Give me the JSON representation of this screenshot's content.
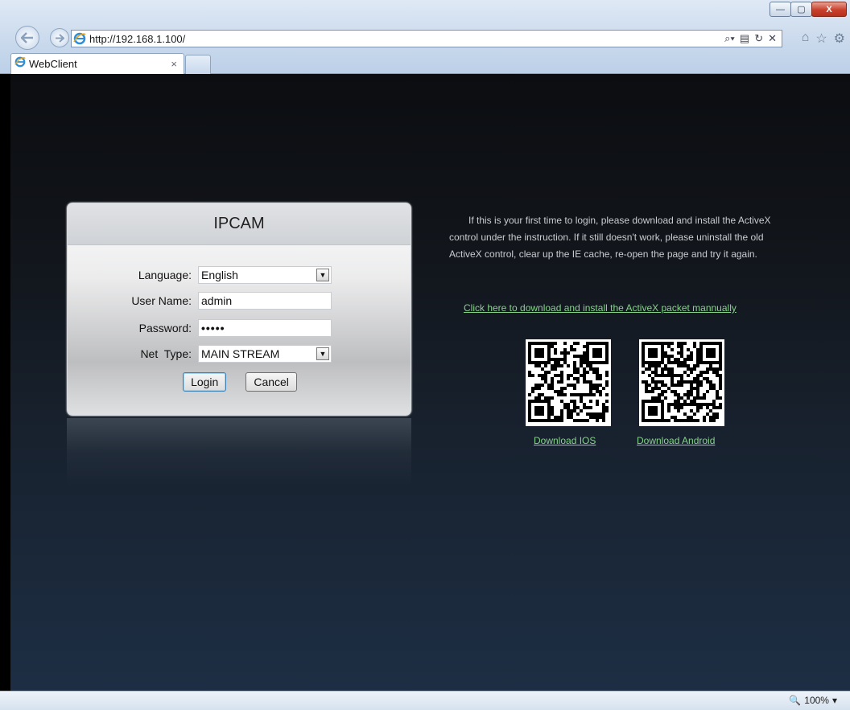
{
  "browser": {
    "url": "http://192.168.1.100/",
    "tab_title": "WebClient",
    "tab_close": "×",
    "window_buttons": {
      "minimize": "—",
      "maximize": "▢",
      "close": "X"
    },
    "zoom": "100%",
    "icons": [
      "back-arrow-icon",
      "forward-arrow-icon",
      "ie-logo-icon",
      "search-icon",
      "compat-view-icon",
      "refresh-icon",
      "stop-icon",
      "home-icon",
      "favorites-star-icon",
      "settings-gear-icon",
      "zoom-icon"
    ]
  },
  "login": {
    "title": "IPCAM",
    "language_label": "Language:",
    "language_value": "English",
    "username_label": "User Name:",
    "username_value": "admin",
    "password_label": "Password:",
    "password_value": "•••••",
    "nettype_label": "Net  Type:",
    "nettype_value": "MAIN STREAM",
    "login_button": "Login",
    "cancel_button": "Cancel"
  },
  "info": {
    "text": "If this is your first time to login, please download and install the ActiveX control under the instruction. If it still doesn't work, please uninstall the old ActiveX control, clear up the IE cache, re-open the page and try it again.",
    "activex_link": "Click here to download and install the ActiveX packet mannually",
    "ios_link": "Download IOS",
    "android_link": "Download Android"
  },
  "colors": {
    "link": "#86d28a",
    "info_text": "#c9ccd1",
    "background_top": "#0b0d11",
    "background_bottom": "#1d2e44"
  }
}
